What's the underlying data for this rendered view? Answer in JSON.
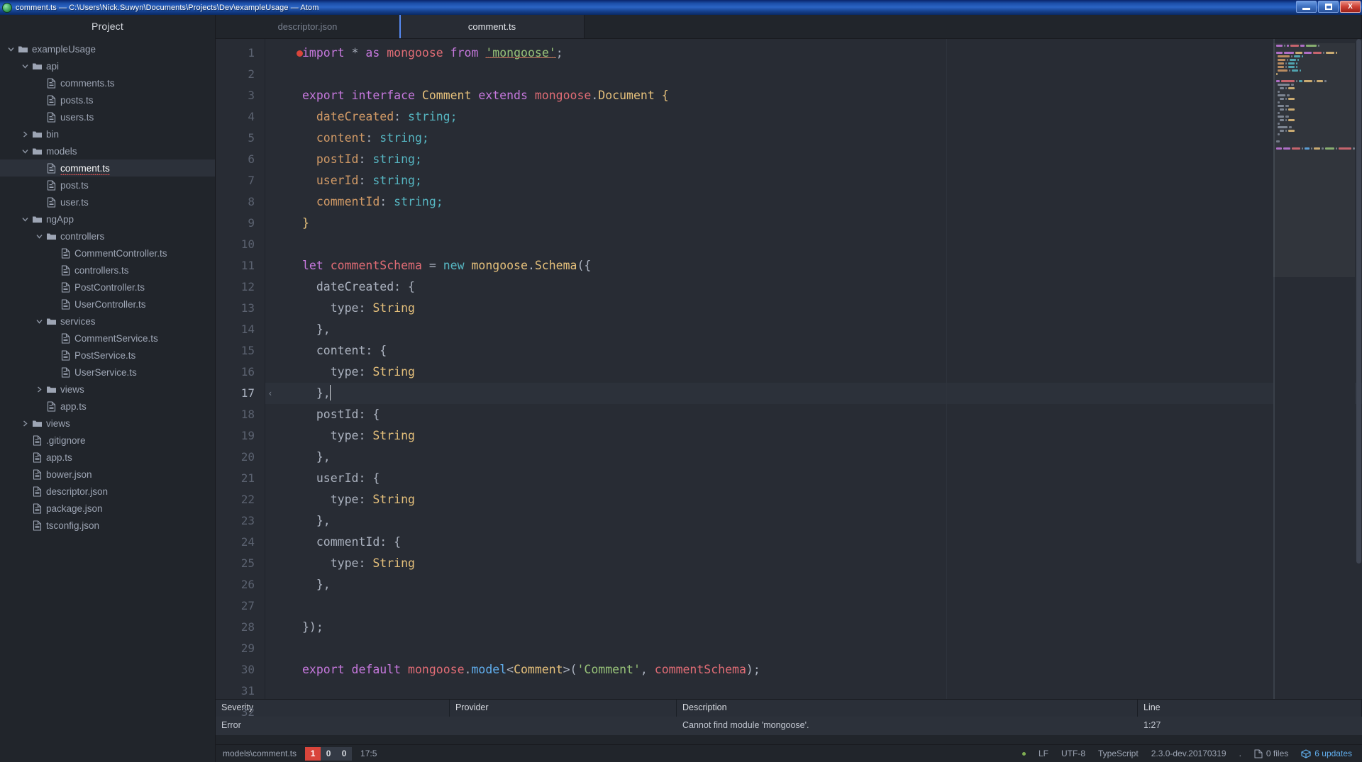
{
  "window": {
    "title": "comment.ts — C:\\Users\\Nick.Suwyn\\Documents\\Projects\\Dev\\exampleUsage — Atom",
    "minimize_label": "Minimize",
    "maximize_label": "Maximize",
    "close_label": "X"
  },
  "sidebar": {
    "header": "Project",
    "items": [
      {
        "label": "exampleUsage",
        "type": "folder",
        "depth": 0,
        "expanded": true,
        "selected": false
      },
      {
        "label": "api",
        "type": "folder",
        "depth": 1,
        "expanded": true,
        "selected": false
      },
      {
        "label": "comments.ts",
        "type": "file",
        "depth": 2,
        "selected": false
      },
      {
        "label": "posts.ts",
        "type": "file",
        "depth": 2,
        "selected": false
      },
      {
        "label": "users.ts",
        "type": "file",
        "depth": 2,
        "selected": false
      },
      {
        "label": "bin",
        "type": "folder",
        "depth": 1,
        "expanded": false,
        "selected": false
      },
      {
        "label": "models",
        "type": "folder",
        "depth": 1,
        "expanded": true,
        "selected": false
      },
      {
        "label": "comment.ts",
        "type": "file",
        "depth": 2,
        "selected": true,
        "error": true
      },
      {
        "label": "post.ts",
        "type": "file",
        "depth": 2,
        "selected": false
      },
      {
        "label": "user.ts",
        "type": "file",
        "depth": 2,
        "selected": false
      },
      {
        "label": "ngApp",
        "type": "folder",
        "depth": 1,
        "expanded": true,
        "selected": false
      },
      {
        "label": "controllers",
        "type": "folder",
        "depth": 2,
        "expanded": true,
        "selected": false
      },
      {
        "label": "CommentController.ts",
        "type": "file",
        "depth": 3,
        "selected": false
      },
      {
        "label": "controllers.ts",
        "type": "file",
        "depth": 3,
        "selected": false
      },
      {
        "label": "PostController.ts",
        "type": "file",
        "depth": 3,
        "selected": false
      },
      {
        "label": "UserController.ts",
        "type": "file",
        "depth": 3,
        "selected": false
      },
      {
        "label": "services",
        "type": "folder",
        "depth": 2,
        "expanded": true,
        "selected": false
      },
      {
        "label": "CommentService.ts",
        "type": "file",
        "depth": 3,
        "selected": false
      },
      {
        "label": "PostService.ts",
        "type": "file",
        "depth": 3,
        "selected": false
      },
      {
        "label": "UserService.ts",
        "type": "file",
        "depth": 3,
        "selected": false
      },
      {
        "label": "views",
        "type": "folder",
        "depth": 2,
        "expanded": false,
        "selected": false
      },
      {
        "label": "app.ts",
        "type": "file",
        "depth": 2,
        "selected": false
      },
      {
        "label": "views",
        "type": "folder",
        "depth": 1,
        "expanded": false,
        "selected": false
      },
      {
        "label": ".gitignore",
        "type": "file",
        "depth": 1,
        "selected": false
      },
      {
        "label": "app.ts",
        "type": "file",
        "depth": 1,
        "selected": false
      },
      {
        "label": "bower.json",
        "type": "file",
        "depth": 1,
        "selected": false
      },
      {
        "label": "descriptor.json",
        "type": "file",
        "depth": 1,
        "selected": false
      },
      {
        "label": "package.json",
        "type": "file",
        "depth": 1,
        "selected": false
      },
      {
        "label": "tsconfig.json",
        "type": "file",
        "depth": 1,
        "selected": false
      }
    ]
  },
  "tabs": [
    {
      "label": "descriptor.json",
      "active": false
    },
    {
      "label": "comment.ts",
      "active": true
    }
  ],
  "editor": {
    "cursor_line": 17,
    "lines": [
      {
        "n": 1,
        "error_marker": true,
        "tokens": [
          {
            "t": "import",
            "c": "kw"
          },
          {
            "t": " ",
            "c": "def"
          },
          {
            "t": "*",
            "c": "pun"
          },
          {
            "t": " ",
            "c": "def"
          },
          {
            "t": "as",
            "c": "kw"
          },
          {
            "t": " ",
            "c": "def"
          },
          {
            "t": "mongoose",
            "c": "var"
          },
          {
            "t": " ",
            "c": "def"
          },
          {
            "t": "from",
            "c": "kw"
          },
          {
            "t": " ",
            "c": "def"
          },
          {
            "t": "'mongoose'",
            "c": "str underline squiggle"
          },
          {
            "t": ";",
            "c": "pun"
          }
        ]
      },
      {
        "n": 2,
        "tokens": []
      },
      {
        "n": 3,
        "tokens": [
          {
            "t": "export",
            "c": "kw"
          },
          {
            "t": " ",
            "c": "def"
          },
          {
            "t": "interface",
            "c": "kw"
          },
          {
            "t": " ",
            "c": "def"
          },
          {
            "t": "Comment",
            "c": "cls"
          },
          {
            "t": " ",
            "c": "def"
          },
          {
            "t": "extends",
            "c": "kw"
          },
          {
            "t": " ",
            "c": "def"
          },
          {
            "t": "mongoose",
            "c": "var"
          },
          {
            "t": ".",
            "c": "pun"
          },
          {
            "t": "Document",
            "c": "cls"
          },
          {
            "t": " ",
            "c": "def"
          },
          {
            "t": "{",
            "c": "cls"
          }
        ]
      },
      {
        "n": 4,
        "tokens": [
          {
            "t": "  dateCreated",
            "c": "prop"
          },
          {
            "t": ": ",
            "c": "pun"
          },
          {
            "t": "string",
            "c": "type"
          },
          {
            "t": ";",
            "c": "type"
          }
        ]
      },
      {
        "n": 5,
        "tokens": [
          {
            "t": "  content",
            "c": "prop"
          },
          {
            "t": ": ",
            "c": "pun"
          },
          {
            "t": "string",
            "c": "type"
          },
          {
            "t": ";",
            "c": "type"
          }
        ]
      },
      {
        "n": 6,
        "tokens": [
          {
            "t": "  postId",
            "c": "prop"
          },
          {
            "t": ": ",
            "c": "pun"
          },
          {
            "t": "string",
            "c": "type"
          },
          {
            "t": ";",
            "c": "type"
          }
        ]
      },
      {
        "n": 7,
        "tokens": [
          {
            "t": "  userId",
            "c": "prop"
          },
          {
            "t": ": ",
            "c": "pun"
          },
          {
            "t": "string",
            "c": "type"
          },
          {
            "t": ";",
            "c": "type"
          }
        ]
      },
      {
        "n": 8,
        "tokens": [
          {
            "t": "  commentId",
            "c": "prop"
          },
          {
            "t": ": ",
            "c": "pun"
          },
          {
            "t": "string",
            "c": "type"
          },
          {
            "t": ";",
            "c": "type"
          }
        ]
      },
      {
        "n": 9,
        "tokens": [
          {
            "t": "}",
            "c": "cls"
          }
        ]
      },
      {
        "n": 10,
        "tokens": []
      },
      {
        "n": 11,
        "tokens": [
          {
            "t": "let",
            "c": "kw"
          },
          {
            "t": " ",
            "c": "def"
          },
          {
            "t": "commentSchema",
            "c": "var"
          },
          {
            "t": " ",
            "c": "def"
          },
          {
            "t": "=",
            "c": "pun"
          },
          {
            "t": " ",
            "c": "def"
          },
          {
            "t": "new",
            "c": "type"
          },
          {
            "t": " ",
            "c": "def"
          },
          {
            "t": "mongoose",
            "c": "cls"
          },
          {
            "t": ".",
            "c": "pun"
          },
          {
            "t": "Schema",
            "c": "cls"
          },
          {
            "t": "({",
            "c": "pun"
          }
        ]
      },
      {
        "n": 12,
        "tokens": [
          {
            "t": "  dateCreated",
            "c": "def"
          },
          {
            "t": ": {",
            "c": "pun"
          }
        ]
      },
      {
        "n": 13,
        "tokens": [
          {
            "t": "    type",
            "c": "def"
          },
          {
            "t": ": ",
            "c": "pun"
          },
          {
            "t": "String",
            "c": "cls"
          }
        ]
      },
      {
        "n": 14,
        "tokens": [
          {
            "t": "  },",
            "c": "pun"
          }
        ]
      },
      {
        "n": 15,
        "tokens": [
          {
            "t": "  content",
            "c": "def"
          },
          {
            "t": ": {",
            "c": "pun"
          }
        ]
      },
      {
        "n": 16,
        "tokens": [
          {
            "t": "    type",
            "c": "def"
          },
          {
            "t": ": ",
            "c": "pun"
          },
          {
            "t": "String",
            "c": "cls"
          }
        ]
      },
      {
        "n": 17,
        "cursor": true,
        "tokens": [
          {
            "t": "  },",
            "c": "pun"
          }
        ]
      },
      {
        "n": 18,
        "tokens": [
          {
            "t": "  postId",
            "c": "def"
          },
          {
            "t": ": {",
            "c": "pun"
          }
        ]
      },
      {
        "n": 19,
        "tokens": [
          {
            "t": "    type",
            "c": "def"
          },
          {
            "t": ": ",
            "c": "pun"
          },
          {
            "t": "String",
            "c": "cls"
          }
        ]
      },
      {
        "n": 20,
        "tokens": [
          {
            "t": "  },",
            "c": "pun"
          }
        ]
      },
      {
        "n": 21,
        "tokens": [
          {
            "t": "  userId",
            "c": "def"
          },
          {
            "t": ": {",
            "c": "pun"
          }
        ]
      },
      {
        "n": 22,
        "tokens": [
          {
            "t": "    type",
            "c": "def"
          },
          {
            "t": ": ",
            "c": "pun"
          },
          {
            "t": "String",
            "c": "cls"
          }
        ]
      },
      {
        "n": 23,
        "tokens": [
          {
            "t": "  },",
            "c": "pun"
          }
        ]
      },
      {
        "n": 24,
        "tokens": [
          {
            "t": "  commentId",
            "c": "def"
          },
          {
            "t": ": {",
            "c": "pun"
          }
        ]
      },
      {
        "n": 25,
        "tokens": [
          {
            "t": "    type",
            "c": "def"
          },
          {
            "t": ": ",
            "c": "pun"
          },
          {
            "t": "String",
            "c": "cls"
          }
        ]
      },
      {
        "n": 26,
        "tokens": [
          {
            "t": "  },",
            "c": "pun"
          }
        ]
      },
      {
        "n": 27,
        "tokens": []
      },
      {
        "n": 28,
        "tokens": [
          {
            "t": "});",
            "c": "pun"
          }
        ]
      },
      {
        "n": 29,
        "tokens": []
      },
      {
        "n": 30,
        "tokens": [
          {
            "t": "export",
            "c": "kw"
          },
          {
            "t": " ",
            "c": "def"
          },
          {
            "t": "default",
            "c": "kw"
          },
          {
            "t": " ",
            "c": "def"
          },
          {
            "t": "mongoose",
            "c": "var"
          },
          {
            "t": ".",
            "c": "pun"
          },
          {
            "t": "model",
            "c": "fn"
          },
          {
            "t": "<",
            "c": "pun"
          },
          {
            "t": "Comment",
            "c": "cls"
          },
          {
            "t": ">(",
            "c": "pun"
          },
          {
            "t": "'Comment'",
            "c": "str"
          },
          {
            "t": ", ",
            "c": "pun"
          },
          {
            "t": "commentSchema",
            "c": "var"
          },
          {
            "t": ");",
            "c": "pun"
          }
        ]
      },
      {
        "n": 31,
        "tokens": []
      },
      {
        "n": 32,
        "tokens": []
      }
    ]
  },
  "diagnostics": {
    "columns": [
      "Severity",
      "Provider",
      "Description",
      "Line"
    ],
    "rows": [
      {
        "severity": "Error",
        "provider": "",
        "description": "Cannot find module 'mongoose'.",
        "line": "1:27"
      }
    ]
  },
  "statusbar": {
    "path": "models\\comment.ts",
    "errors": "1",
    "warnings": "0",
    "infos": "0",
    "cursor_position": "17:5",
    "line_ending": "LF",
    "encoding": "UTF-8",
    "grammar": "TypeScript",
    "version": "2.3.0-dev.20170319",
    "branch": ".",
    "files_changed": "0 files",
    "updates": "6 updates"
  }
}
